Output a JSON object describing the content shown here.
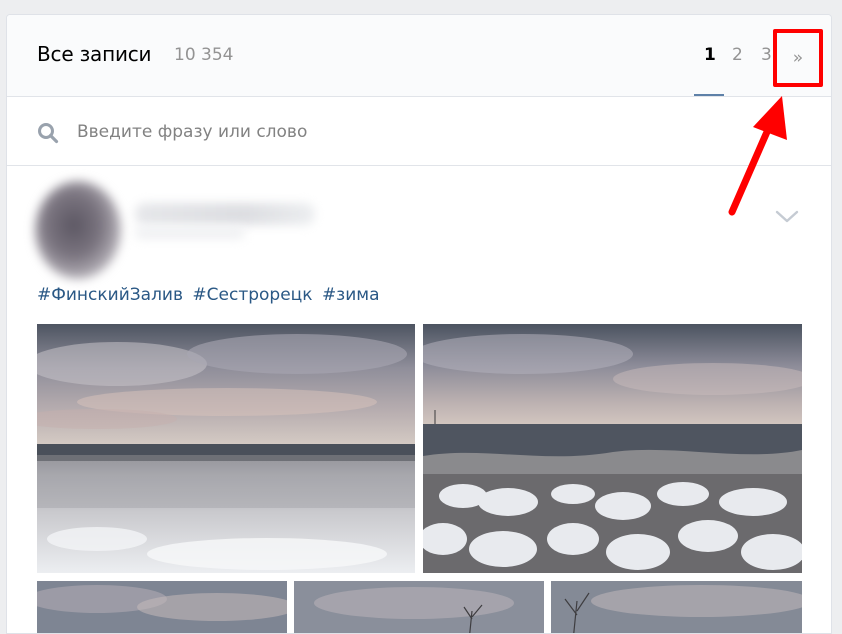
{
  "header": {
    "title": "Все записи",
    "count": "10 354",
    "pages": [
      "1",
      "2",
      "3"
    ],
    "active_page": "1",
    "next_label": "»"
  },
  "search": {
    "placeholder": "Введите фразу или слово"
  },
  "post": {
    "hashtags": [
      "#ФинскийЗалив",
      "#Сестрорецк",
      "#зима"
    ]
  },
  "colors": {
    "link": "#2a5885",
    "highlight": "#ff0000",
    "page_underline": "#5e81a8"
  },
  "icons": [
    "search-icon",
    "chevron-down-icon",
    "arrow-annotation"
  ]
}
